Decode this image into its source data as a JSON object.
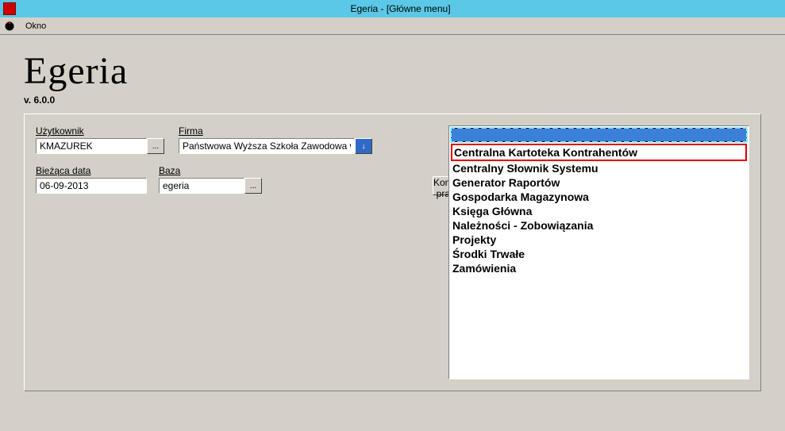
{
  "window": {
    "title": "Egeria - [Główne menu]"
  },
  "menubar": {
    "item1": "Okno"
  },
  "app": {
    "logo": "Egeria",
    "version": "v. 6.0.0"
  },
  "fields": {
    "user_label": "Użytkownik",
    "user_value": "KMAZUREK",
    "company_label": "Firma",
    "company_value": "Państwowa Wyższa Szkoła Zawodowa w Chełmie",
    "date_label": "Bieżąca data",
    "date_value": "06-09-2013",
    "db_label": "Baza",
    "db_value": "egeria"
  },
  "buttons": {
    "end_work": "Koniec pracy",
    "ellipsis": "...",
    "down": "↓"
  },
  "modules": {
    "selected": "",
    "items": [
      "Centralna Kartoteka Kontrahentów",
      "Centralny Słownik Systemu",
      "Generator Raportów",
      "Gospodarka Magazynowa",
      "Księga Główna",
      "Należności - Zobowiązania",
      "Projekty",
      "Środki Trwałe",
      "Zamówienia"
    ],
    "highlighted_index": 0
  }
}
